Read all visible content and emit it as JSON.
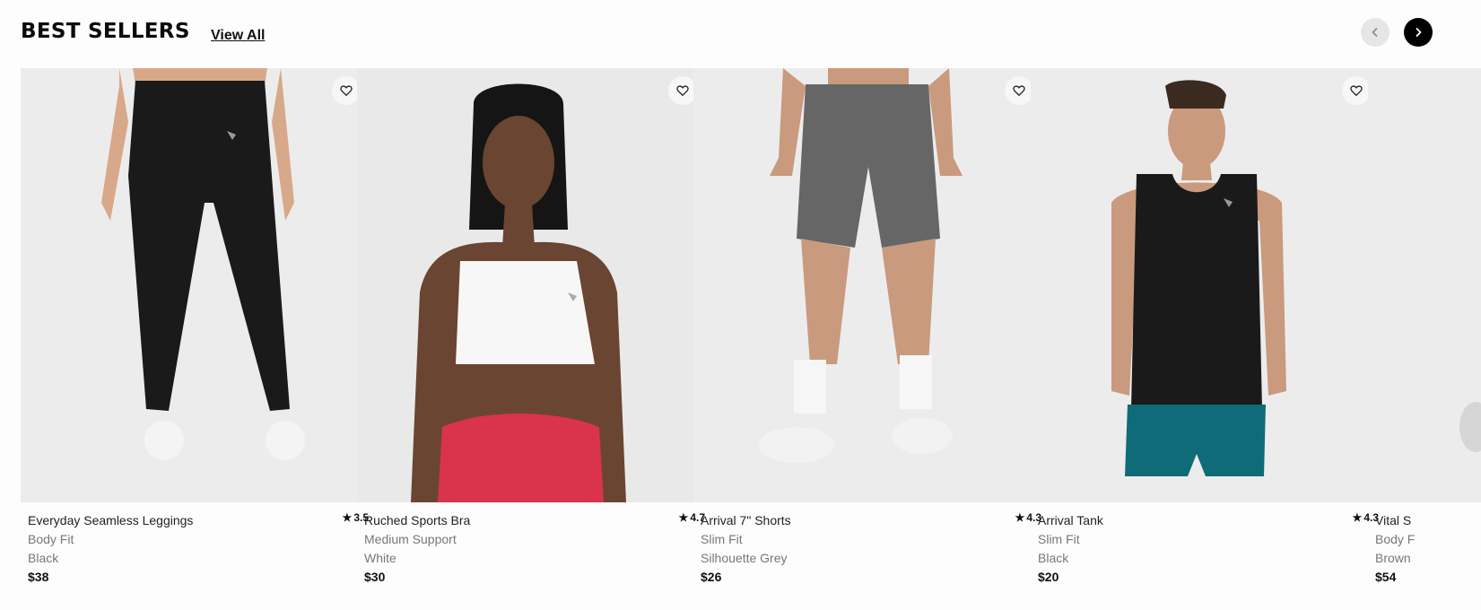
{
  "section": {
    "title": "BEST SELLERS",
    "view_all": "View All"
  },
  "nav": {
    "prev_icon": "chevron-left-icon",
    "next_icon": "chevron-right-icon"
  },
  "products": [
    {
      "name": "Everyday Seamless Leggings",
      "rating": "3.5",
      "fit": "Body Fit",
      "color": "Black",
      "price": "$38",
      "image": "model-black-leggings"
    },
    {
      "name": "Ruched Sports Bra",
      "rating": "4.7",
      "fit": "Medium Support",
      "color": "White",
      "price": "$30",
      "image": "model-white-sports-bra"
    },
    {
      "name": "Arrival 7\" Shorts",
      "rating": "4.3",
      "fit": "Slim Fit",
      "color": "Silhouette Grey",
      "price": "$26",
      "image": "model-grey-shorts"
    },
    {
      "name": "Arrival Tank",
      "rating": "4.3",
      "fit": "Slim Fit",
      "color": "Black",
      "price": "$20",
      "image": "model-black-tank"
    },
    {
      "name": "Vital S",
      "rating": "",
      "fit": "Body F",
      "color": "Brown",
      "price": "$54",
      "image": "model-partial"
    }
  ],
  "colors": {
    "card_bg": "#ebebeb",
    "nav_next_bg": "#000000",
    "nav_prev_bg": "#e6e6e6"
  }
}
